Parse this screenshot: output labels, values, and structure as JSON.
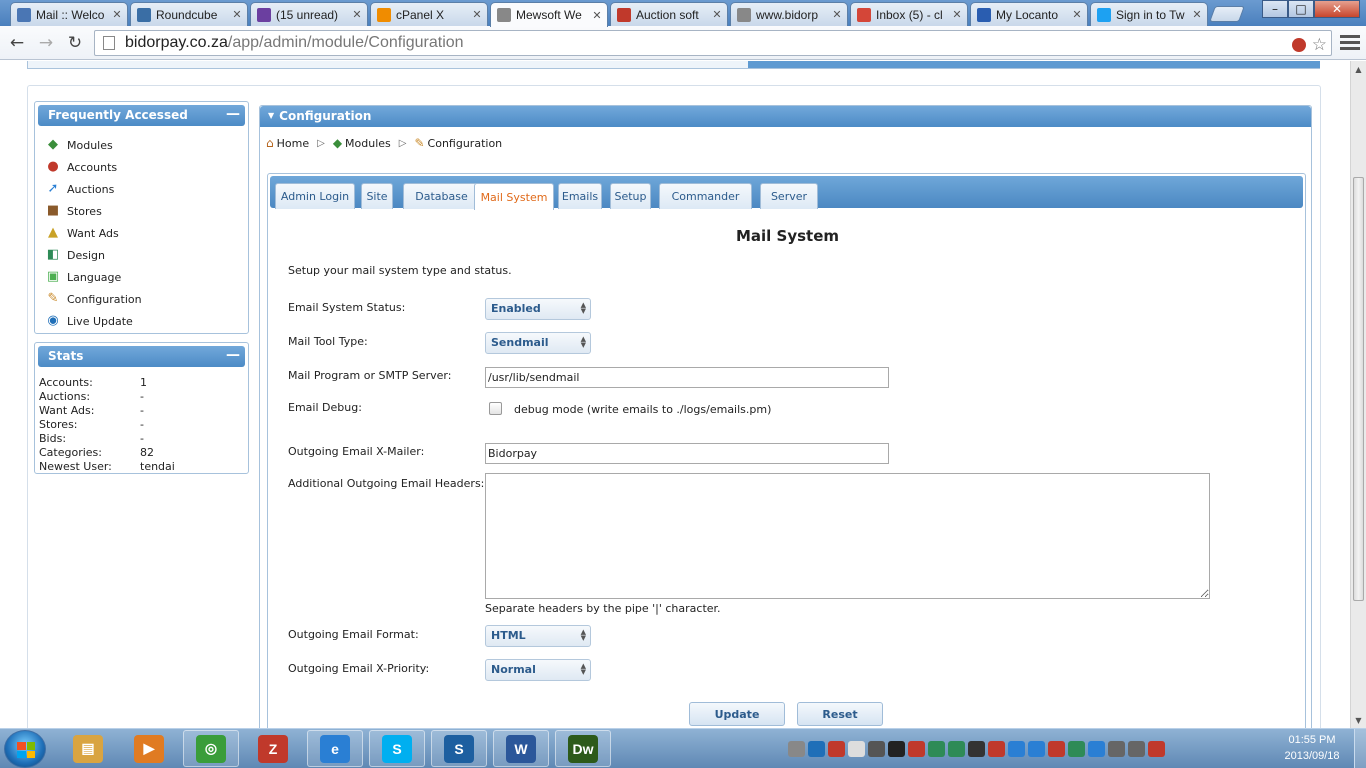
{
  "browser": {
    "tabs": [
      {
        "label": "Mail :: Welco",
        "icon": "mail-icon",
        "color": "#4a76b4"
      },
      {
        "label": "Roundcube",
        "icon": "roundcube-icon",
        "color": "#3a6ea5"
      },
      {
        "label": "(15 unread)",
        "icon": "yahoo-mail-icon",
        "color": "#6b3fa0"
      },
      {
        "label": "cPanel X",
        "icon": "cpanel-icon",
        "color": "#f08c00"
      },
      {
        "label": "Mewsoft We",
        "icon": "page-icon",
        "color": "#888888"
      },
      {
        "label": "Auction soft",
        "icon": "auction-icon",
        "color": "#c0392b"
      },
      {
        "label": "www.bidorp",
        "icon": "page-icon",
        "color": "#888888"
      },
      {
        "label": "Inbox (5) - cl",
        "icon": "gmail-icon",
        "color": "#d44638"
      },
      {
        "label": "My Locanto",
        "icon": "locanto-icon",
        "color": "#2a5db0"
      },
      {
        "label": "Sign in to Tw",
        "icon": "twitter-icon",
        "color": "#1da1f2"
      }
    ],
    "active_tab": 4,
    "url_host": "bidorpay.co.za",
    "url_path": "/app/admin/module/Configuration"
  },
  "sidebar": {
    "frequently_accessed": {
      "title": "Frequently Accessed",
      "items": [
        {
          "label": "Modules",
          "icon": "modules-icon",
          "glyph": "◆",
          "color": "#3b8e3b"
        },
        {
          "label": "Accounts",
          "icon": "accounts-icon",
          "glyph": "●",
          "color": "#c0392b"
        },
        {
          "label": "Auctions",
          "icon": "auctions-icon",
          "glyph": "➚",
          "color": "#2a7fd4"
        },
        {
          "label": "Stores",
          "icon": "stores-icon",
          "glyph": "■",
          "color": "#8a5a2b"
        },
        {
          "label": "Want Ads",
          "icon": "want-ads-icon",
          "glyph": "▲",
          "color": "#c9a227"
        },
        {
          "label": "Design",
          "icon": "design-icon",
          "glyph": "◧",
          "color": "#2e8b57"
        },
        {
          "label": "Language",
          "icon": "language-icon",
          "glyph": "▣",
          "color": "#4caf50"
        },
        {
          "label": "Configuration",
          "icon": "configuration-icon",
          "glyph": "✎",
          "color": "#c98a2b"
        },
        {
          "label": "Live Update",
          "icon": "live-update-icon",
          "glyph": "◉",
          "color": "#1f6fb8"
        }
      ]
    },
    "stats": {
      "title": "Stats",
      "rows": [
        {
          "key": "Accounts:",
          "value": "1"
        },
        {
          "key": "Auctions:",
          "value": "-"
        },
        {
          "key": "Want Ads:",
          "value": "-"
        },
        {
          "key": "Stores:",
          "value": "-"
        },
        {
          "key": "Bids:",
          "value": "-"
        },
        {
          "key": "Categories:",
          "value": "82"
        },
        {
          "key": "Newest User:",
          "value": "tendai"
        }
      ]
    }
  },
  "main": {
    "title": "Configuration",
    "breadcrumb": {
      "home": "Home",
      "modules": "Modules",
      "current": "Configuration"
    },
    "tabs": [
      "Admin Login",
      "Site",
      "Database",
      "Mail System",
      "Emails",
      "Setup",
      "Commander",
      "Server"
    ],
    "active_tab": "Mail System",
    "form": {
      "title": "Mail System",
      "intro": "Setup your mail system type and status.",
      "email_status_label": "Email System Status:",
      "email_status_value": "Enabled",
      "mail_tool_label": "Mail Tool Type:",
      "mail_tool_value": "Sendmail",
      "smtp_label": "Mail Program or SMTP Server:",
      "smtp_value": "/usr/lib/sendmail",
      "debug_label": "Email Debug:",
      "debug_text": "debug mode (write emails to ./logs/emails.pm)",
      "debug_checked": false,
      "xmailer_label": "Outgoing Email X-Mailer:",
      "xmailer_value": "Bidorpay",
      "headers_label": "Additional Outgoing Email Headers:",
      "headers_value": "",
      "headers_hint": "Separate headers by the pipe '|' character.",
      "format_label": "Outgoing Email Format:",
      "format_value": "HTML",
      "priority_label": "Outgoing Email X-Priority:",
      "priority_value": "Normal",
      "update_label": "Update",
      "reset_label": "Reset"
    }
  },
  "taskbar": {
    "apps": [
      {
        "name": "explorer",
        "glyph": "▤",
        "color": "#d9a441"
      },
      {
        "name": "media-player",
        "glyph": "▶",
        "color": "#e07b22"
      },
      {
        "name": "chrome",
        "glyph": "◎",
        "color": "#3a9d3a"
      },
      {
        "name": "filezilla",
        "glyph": "Z",
        "color": "#c0392b"
      },
      {
        "name": "internet-explorer",
        "glyph": "e",
        "color": "#2a7fd4"
      },
      {
        "name": "skype",
        "glyph": "S",
        "color": "#00aff0"
      },
      {
        "name": "app-s",
        "glyph": "S",
        "color": "#1d5fa0"
      },
      {
        "name": "word",
        "glyph": "W",
        "color": "#2b579a"
      },
      {
        "name": "dreamweaver",
        "glyph": "Dw",
        "color": "#2d5a1a"
      }
    ],
    "time": "01:55 PM",
    "date": "2013/09/18"
  }
}
